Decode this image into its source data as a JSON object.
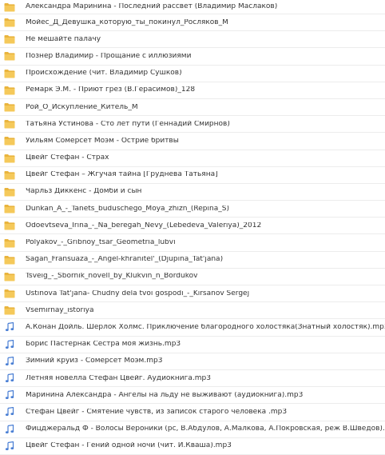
{
  "colors": {
    "folder": "#f5c95a",
    "folder_dark": "#e9b43d",
    "audio": "#4a7fd4",
    "text": "#333333",
    "divider": "#ececec"
  },
  "files": [
    {
      "name": "Александра Маринина - Последний рассвет (Владимир Маслаков)",
      "type": "folder",
      "icon": "folder-icon"
    },
    {
      "name": "Мойес_Д_Девушка_которую_ты_покинул_Росляков_М",
      "type": "folder",
      "icon": "folder-icon"
    },
    {
      "name": "Не мешайте палачу",
      "type": "folder",
      "icon": "folder-icon"
    },
    {
      "name": "Познер Владимир - Прощание с иллюзиями",
      "type": "folder",
      "icon": "folder-icon"
    },
    {
      "name": "Происхождение (чит. Владимир Сушков)",
      "type": "folder",
      "icon": "folder-icon"
    },
    {
      "name": "Ремарк Э.М. - Приют грез (В.Герасимов)_128",
      "type": "folder",
      "icon": "folder-icon"
    },
    {
      "name": "Рой_О_Искупление_Китель_М",
      "type": "folder",
      "icon": "folder-icon"
    },
    {
      "name": "Татьяна Устинова - Сто лет пути (Геннадий Смирнов)",
      "type": "folder",
      "icon": "folder-icon"
    },
    {
      "name": "Уильям Сомерсет Моэм - Остриё бритвы",
      "type": "folder",
      "icon": "folder-icon"
    },
    {
      "name": "Цвейг Стефан - Страх",
      "type": "folder",
      "icon": "folder-icon"
    },
    {
      "name": "Цвейг Стефан – Жгучая тайна [Груднева Татьяна]",
      "type": "folder",
      "icon": "folder-icon"
    },
    {
      "name": "Чарльз Диккенс - Домби и сын",
      "type": "folder",
      "icon": "folder-icon"
    },
    {
      "name": "Dunkan_A_-_Tanets_buduschego_Moya_zhizn_(Repina_S)",
      "type": "folder",
      "icon": "folder-icon"
    },
    {
      "name": "Odoevtseva_Irina_-_Na_beregah_Nevy_(Lebedeva_Valeriya)_2012",
      "type": "folder",
      "icon": "folder-icon"
    },
    {
      "name": "Polyakov_-_Gribnoy_tsar_Geometria_lubvi",
      "type": "folder",
      "icon": "folder-icon"
    },
    {
      "name": "Sagan_Fransuaza_-_Angel-khranitel'_(Djupina_Tat'jana)",
      "type": "folder",
      "icon": "folder-icon"
    },
    {
      "name": "Tsveig_-_Sbornik_novell_by_Klukvin_n_Bordukov",
      "type": "folder",
      "icon": "folder-icon"
    },
    {
      "name": "Ustinova Tat'jana- Chudny dela tvoi gospodi_-_Kirsanov Sergej",
      "type": "folder",
      "icon": "folder-icon"
    },
    {
      "name": "Vsemirnay_istoriya",
      "type": "folder",
      "icon": "folder-icon"
    },
    {
      "name": "А.Конан Дойль. Шерлок Холмс. Приключение благородного холостяка(Знатный холостяк).mp3",
      "type": "audio",
      "icon": "music-note-icon"
    },
    {
      "name": "Борис Пастернак Сестра моя жизнь.mp3",
      "type": "audio",
      "icon": "music-note-icon"
    },
    {
      "name": "Зимний круиз - Сомерсет Моэм.mp3",
      "type": "audio",
      "icon": "music-note-icon"
    },
    {
      "name": "Летняя новелла Стефан Цвейг. Аудиокнига.mp3",
      "type": "audio",
      "icon": "music-note-icon"
    },
    {
      "name": "Маринина Александра - Ангелы на льду не выживают (аудиокнига).mp3",
      "type": "audio",
      "icon": "music-note-icon"
    },
    {
      "name": "Стефан Цвейг - Смятение чувств, из записок старого человека .mp3",
      "type": "audio",
      "icon": "music-note-icon"
    },
    {
      "name": "Фицджеральд Ф - Волосы Вероники (рс, В.Абдулов, А.Малкова, А.Покровская, реж В.Шведов).mp3",
      "type": "audio",
      "icon": "music-note-icon"
    },
    {
      "name": "Цвейг Стефан - Гений одной ночи (чит. И.Кваша).mp3",
      "type": "audio",
      "icon": "music-note-icon"
    }
  ]
}
